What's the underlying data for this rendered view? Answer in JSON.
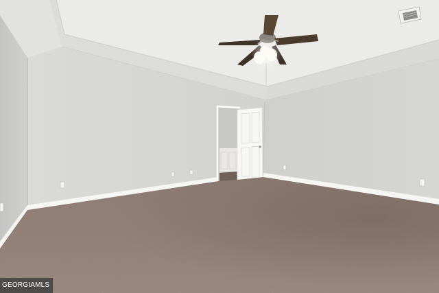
{
  "watermark": {
    "text": "GEORGIAMLS"
  },
  "colors": {
    "wall": "#d9d9d7",
    "ceiling": "#e6e6e4",
    "carpet": "#8d7a70",
    "trim": "#ffffff",
    "fan_blade": "#4a3a2c"
  }
}
